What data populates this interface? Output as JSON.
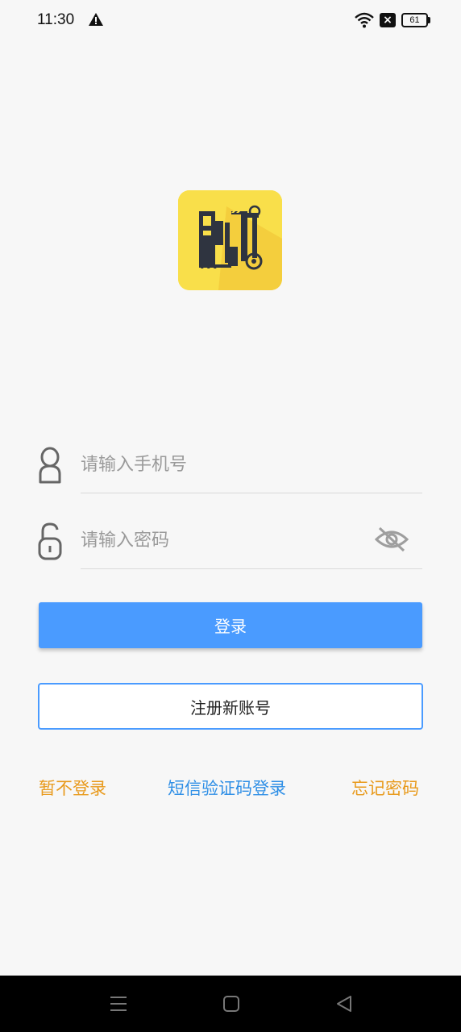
{
  "status_bar": {
    "time": "11:30",
    "battery": "61",
    "close_badge": "×"
  },
  "colors": {
    "primary": "#4a9bff",
    "warning_link": "#e89a1c",
    "info_link": "#2f8fe6",
    "logo_bg": "#f9df4a"
  },
  "icons": [
    "warning-icon",
    "wifi-icon",
    "close-badge-icon",
    "battery-icon",
    "user-icon",
    "lock-icon",
    "eye-off-icon",
    "menu-icon",
    "home-icon",
    "back-icon"
  ],
  "form": {
    "phone_placeholder": "请输入手机号",
    "password_placeholder": "请输入密码",
    "phone_value": "",
    "password_value": ""
  },
  "buttons": {
    "login": "登录",
    "register": "注册新账号"
  },
  "links": {
    "skip": "暂不登录",
    "sms": "短信验证码登录",
    "forgot": "忘记密码"
  }
}
